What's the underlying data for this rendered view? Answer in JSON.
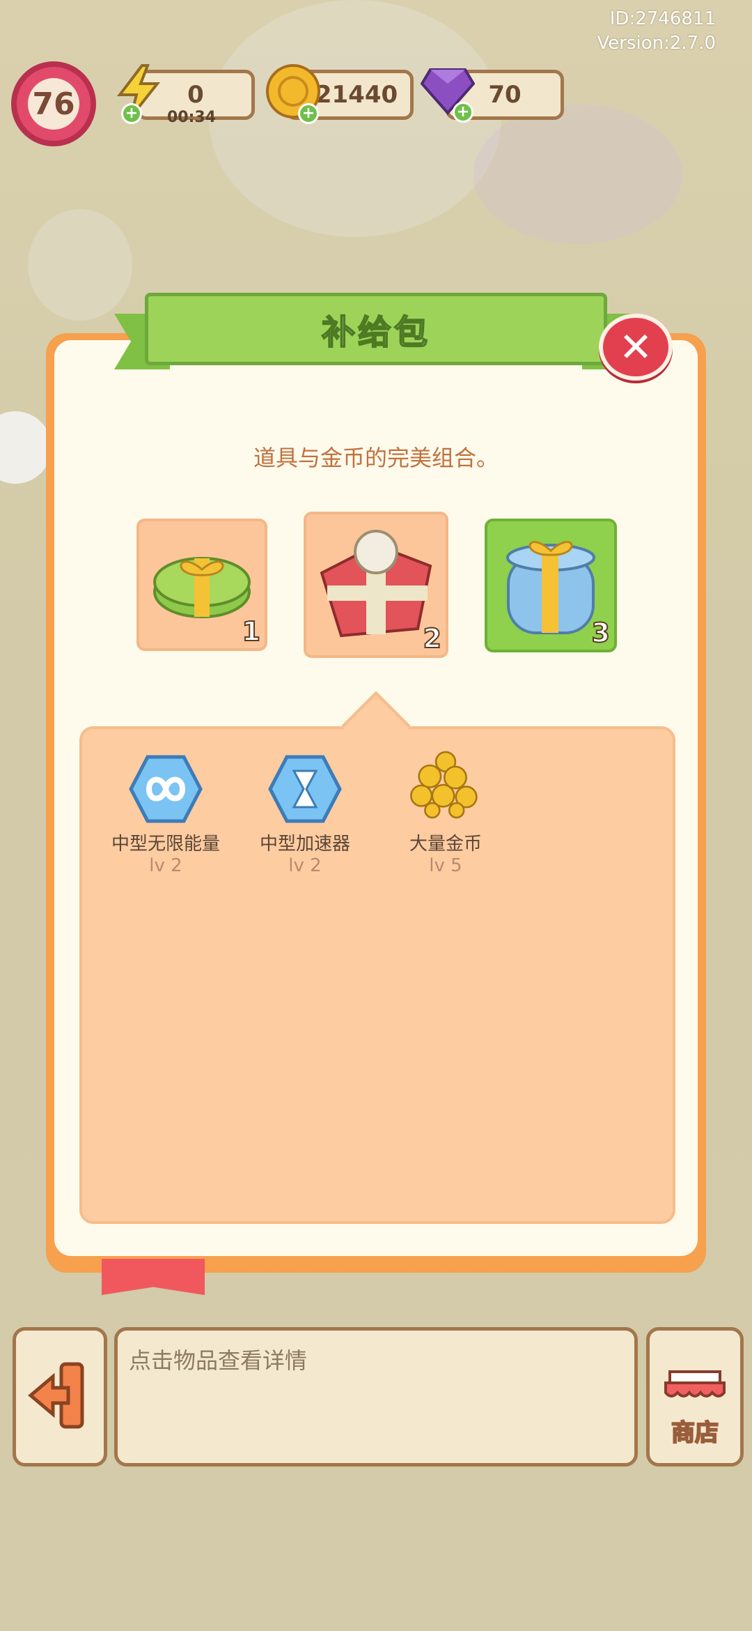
{
  "header": {
    "id_text": "ID:2746811",
    "version_text": "Version:2.7.0",
    "level": "76",
    "energy": "0",
    "energy_timer": "00:34",
    "coins": "21440",
    "gems": "70"
  },
  "modal": {
    "title": "补给包",
    "subtitle": "道具与金币的完美组合。",
    "packs": [
      {
        "number": "1",
        "icon": "gift-box-green-icon",
        "selected": false
      },
      {
        "number": "2",
        "icon": "gift-box-red-icon",
        "selected": true
      },
      {
        "number": "3",
        "icon": "gift-box-blue-icon",
        "selected": false
      }
    ],
    "items": [
      {
        "name": "中型无限能量",
        "level": "lv 2",
        "icon": "infinity-energy-icon"
      },
      {
        "name": "中型加速器",
        "level": "lv 2",
        "icon": "hourglass-accelerator-icon"
      },
      {
        "name": "大量金币",
        "level": "lv 5",
        "icon": "gold-coins-icon"
      }
    ]
  },
  "footer": {
    "info_text": "点击物品查看详情",
    "shop_label": "商店"
  },
  "colors": {
    "modal_border": "#f7a04e",
    "ribbon_green": "#9ed35a",
    "close_red": "#e2404e",
    "panel_peach": "#fecca1"
  }
}
